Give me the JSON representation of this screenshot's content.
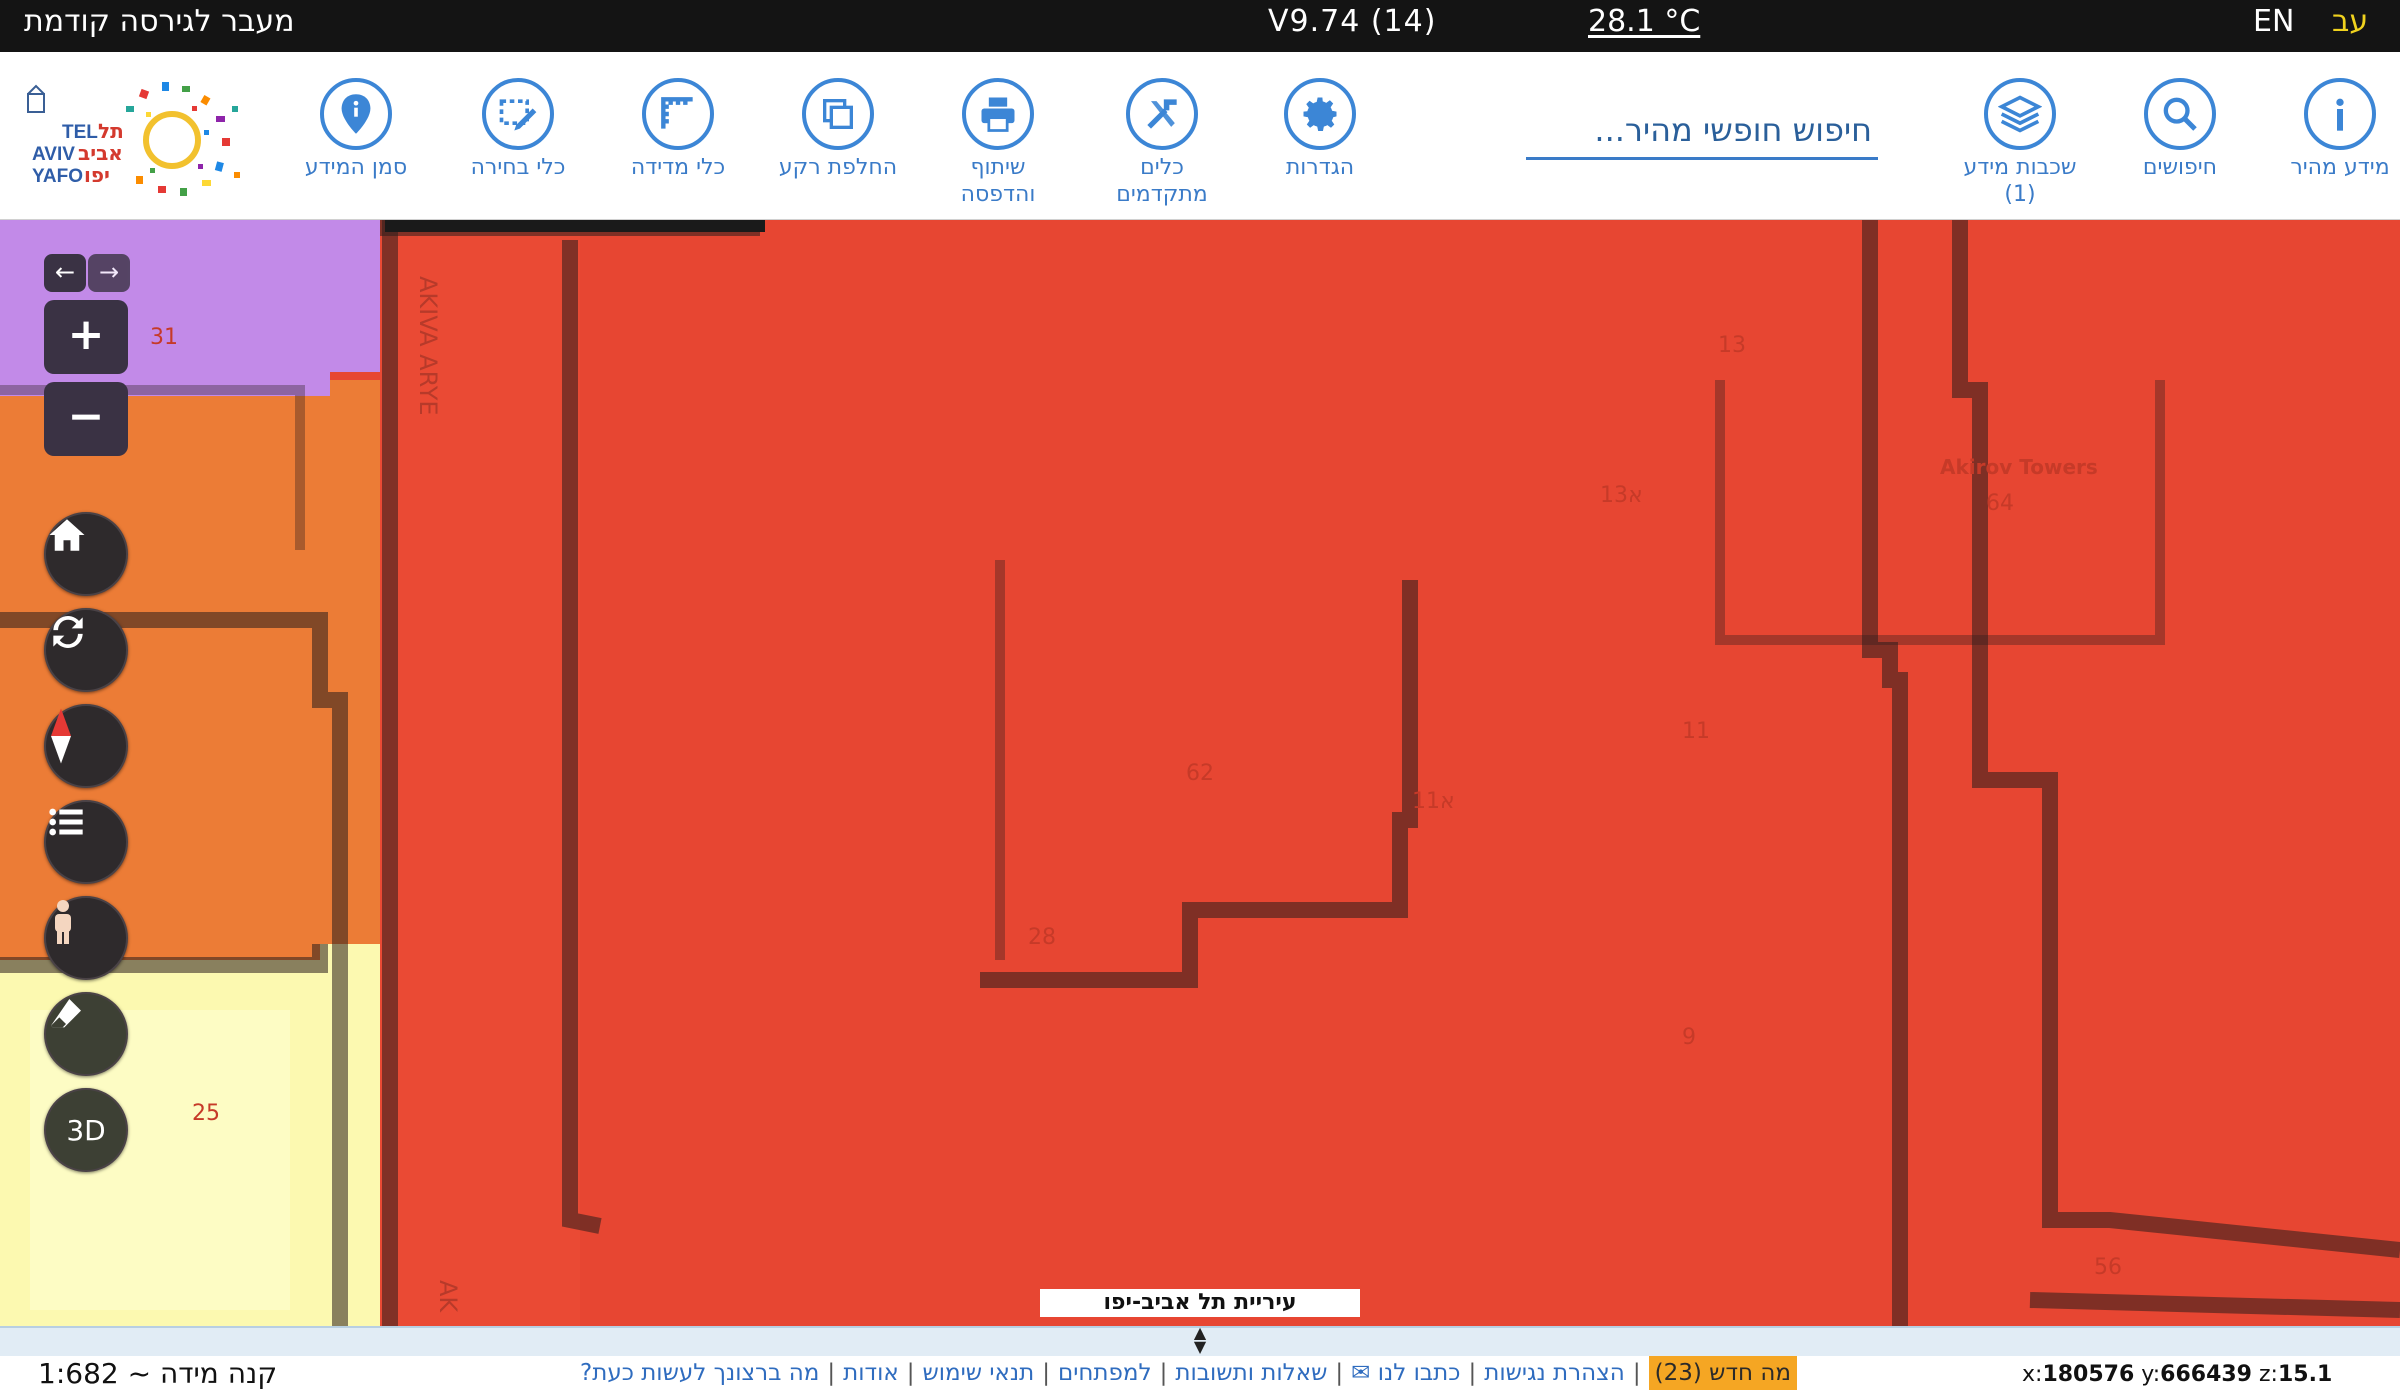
{
  "topbar": {
    "prev_version": "מעבר לגירסה קודמת",
    "version": "V9.74 (14)",
    "temperature": "28.1 °C",
    "lang_en": "EN",
    "lang_he": "עב"
  },
  "toolbar": {
    "tools": [
      {
        "id": "quick-info",
        "label": "מידע מהיר",
        "icon": "info-icon"
      },
      {
        "id": "searches",
        "label": "חיפושים",
        "icon": "magnifier-icon"
      },
      {
        "id": "layers",
        "label": "שכבות מידע",
        "sub": "(1)",
        "icon": "layers-icon"
      },
      {
        "id": "settings",
        "label": "הגדרות",
        "icon": "gear-icon"
      },
      {
        "id": "advanced-tools",
        "label": "כלים",
        "sub": "מתקדמים",
        "icon": "tools-icon"
      },
      {
        "id": "share-print",
        "label": "שיתוף",
        "sub": "והדפסה",
        "icon": "printer-icon"
      },
      {
        "id": "basemap",
        "label": "החלפת רקע",
        "icon": "basemap-icon"
      },
      {
        "id": "measure",
        "label": "כלי מדידה",
        "icon": "ruler-icon"
      },
      {
        "id": "select",
        "label": "כלי בחירה",
        "icon": "select-pencil-icon"
      },
      {
        "id": "info-marker",
        "label": "סמן המידע",
        "icon": "pin-icon"
      }
    ],
    "search_placeholder": "חיפוש חופשי מהיר...",
    "logo_text_en_1": "TEL",
    "logo_text_en_2": "AVIV",
    "logo_text_en_3": "YAFO",
    "logo_text_he_1": "תל",
    "logo_text_he_2": "אביב",
    "logo_text_he_3": "יפו"
  },
  "map": {
    "street_labels": [
      "AKIVA ARYE",
      "AK"
    ],
    "parcel_numbers": [
      "31",
      "13",
      "13א",
      "64",
      "11",
      "11א",
      "62",
      "28",
      "9",
      "25",
      "56"
    ],
    "building_label": "Akirov Towers",
    "city_label": "עיריית תל אביב-יפו",
    "colors": {
      "zone_red": "#e74632",
      "zone_orange": "#ec7c36",
      "zone_purple": "#c28ae8",
      "zone_yellow": "#fcf9b0",
      "outline": "#2a1e1c",
      "accent_blue": "#3c86d6",
      "whats_new": "#f5a623"
    }
  },
  "controls": {
    "three_d": "3D",
    "zoom_in": "+",
    "zoom_out": "−",
    "back": "←",
    "forward": "→"
  },
  "bottom": {
    "scale": "קנה מידה ~ 1:682",
    "links": [
      "מה ברצונך לעשות כעת?",
      "אודות",
      "תנאי שימוש",
      "למפתחים",
      "שאלות ותשובות",
      "כתבו לנו ✉",
      "הצהרת נגישות",
      "מה חדש (23)"
    ],
    "coords": {
      "x_label": "x:",
      "x": "180576",
      "y_label": "y:",
      "y": "666439",
      "z_label": "z:",
      "z": "15.1"
    }
  }
}
